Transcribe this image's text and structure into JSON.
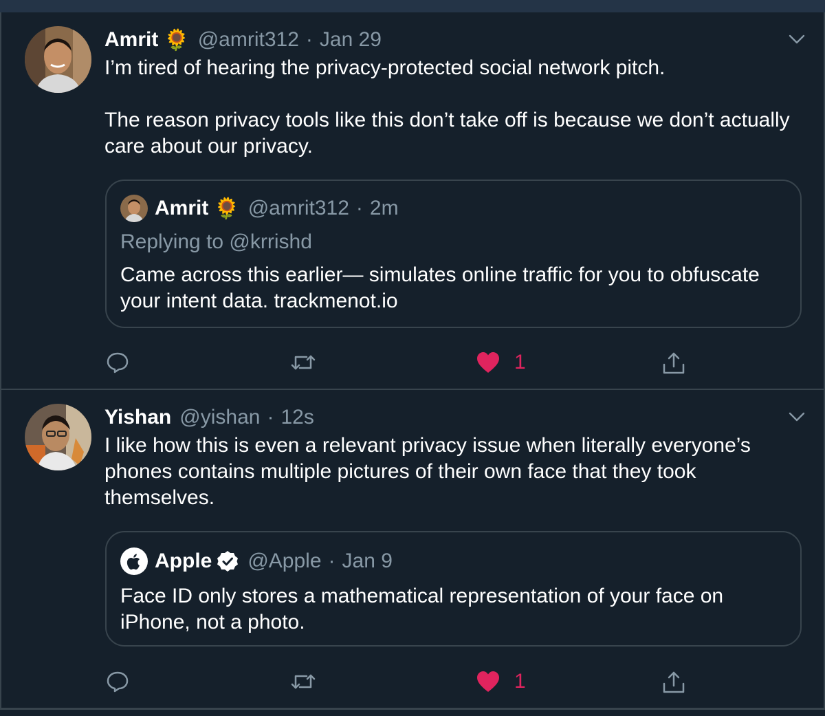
{
  "tweets": [
    {
      "author": {
        "name": "Amrit",
        "emoji": "🌻",
        "handle": "@amrit312",
        "time": "Jan 29"
      },
      "paragraphs": [
        "I’m tired of hearing the privacy-protected social network pitch.",
        "The reason privacy tools like this don’t take off is because we don’t actually care about our privacy."
      ],
      "quote": {
        "name": "Amrit",
        "emoji": "🌻",
        "handle": "@amrit312",
        "time": "2m",
        "replying_to": "Replying to @krrishd",
        "text": "Came across this earlier— simulates online traffic for you to obfuscate your intent data. trackmenot.io"
      },
      "likes": "1"
    },
    {
      "author": {
        "name": "Yishan",
        "handle": "@yishan",
        "time": "12s"
      },
      "paragraphs": [
        "I like how this is even a relevant privacy issue when literally everyone’s phones contains multiple pictures of their own face that they took themselves."
      ],
      "quote": {
        "name": "Apple",
        "handle": "@Apple",
        "time": "Jan 9",
        "text": "Face ID only stores a mathematical representation of your face on iPhone, not a photo."
      },
      "likes": "1"
    }
  ],
  "colors": {
    "background": "#15202b",
    "border": "#38444d",
    "muted": "#8899a6",
    "like": "#e0245e",
    "verified": "#ffffff"
  },
  "icons": [
    "chevron-down-icon",
    "reply-icon",
    "retweet-icon",
    "heart-icon",
    "share-icon",
    "verified-badge-icon",
    "apple-logo-icon"
  ]
}
